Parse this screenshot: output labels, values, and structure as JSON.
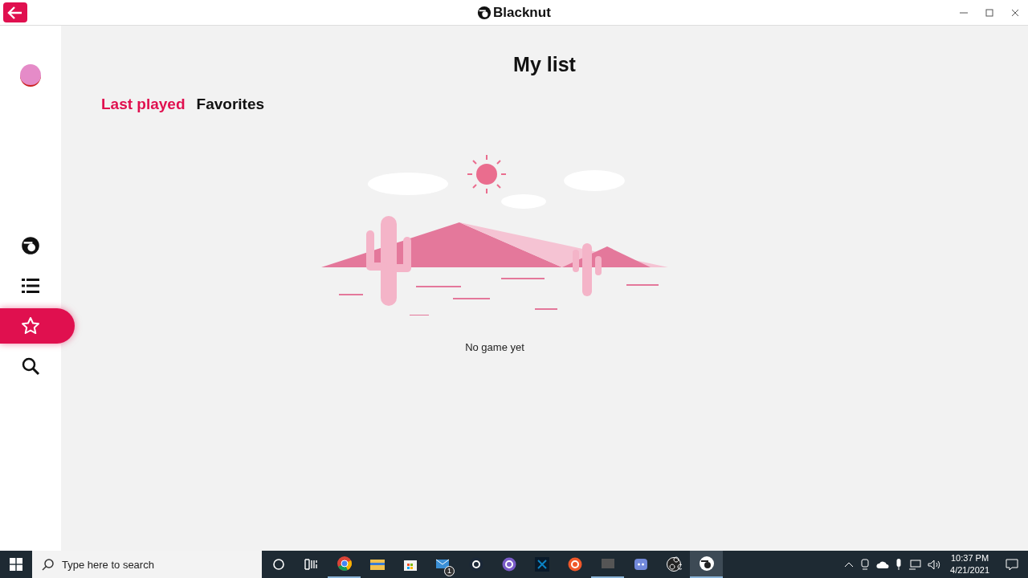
{
  "window": {
    "title": "Blacknut"
  },
  "sidebar": {
    "items": [
      {
        "kind": "logo",
        "selected": false
      },
      {
        "kind": "list",
        "selected": false
      },
      {
        "kind": "star",
        "selected": true
      },
      {
        "kind": "search",
        "selected": false
      }
    ]
  },
  "page": {
    "title": "My list"
  },
  "tabs": [
    {
      "label": "Last played",
      "selected": true
    },
    {
      "label": "Favorites",
      "selected": false
    }
  ],
  "empty_state": {
    "message": "No game yet"
  },
  "taskbar": {
    "search": {
      "placeholder": "Type here to search"
    },
    "apps": [
      {
        "kind": "chrome",
        "running": true,
        "selected": false
      },
      {
        "kind": "folder",
        "running": false,
        "selected": false
      },
      {
        "kind": "store",
        "running": false,
        "selected": false
      },
      {
        "kind": "mail",
        "running": false,
        "selected": false,
        "badge": "1"
      },
      {
        "kind": "steam",
        "running": false,
        "selected": false
      },
      {
        "kind": "rings",
        "running": false,
        "selected": false
      },
      {
        "kind": "bolt",
        "running": false,
        "selected": false
      },
      {
        "kind": "origin",
        "running": false,
        "selected": false
      },
      {
        "kind": "oc",
        "running": true,
        "selected": false
      },
      {
        "kind": "discord",
        "running": false,
        "selected": false
      },
      {
        "kind": "obs",
        "running": false,
        "selected": false
      },
      {
        "kind": "logo",
        "running": true,
        "selected": true
      }
    ],
    "time": "10:37 PM",
    "date": "4/21/2021"
  }
}
